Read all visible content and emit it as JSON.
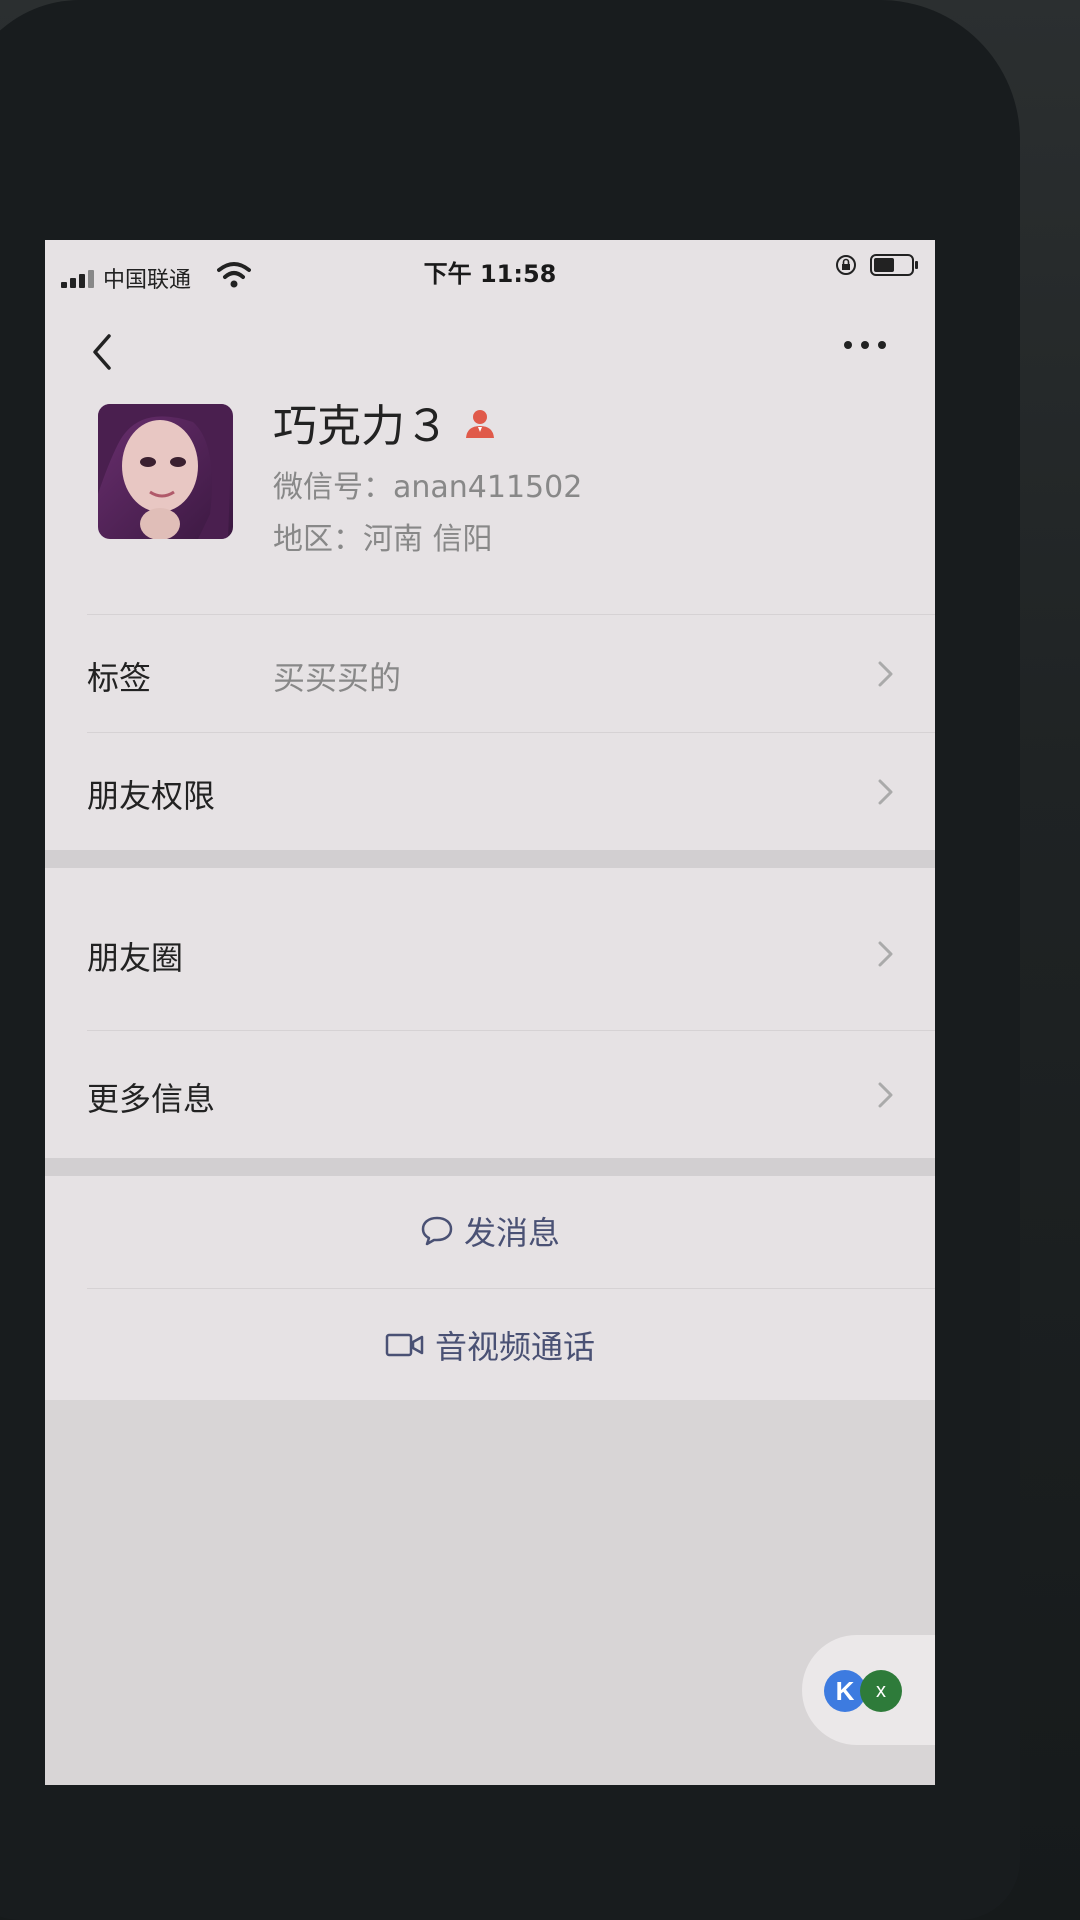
{
  "status_bar": {
    "carrier": "中国联通",
    "time": "下午 11:58"
  },
  "nav": {
    "back_icon": "chevron-left-icon",
    "more_icon": "more-dots-icon"
  },
  "profile": {
    "nickname": "巧克力３",
    "wechat_id_label": "微信号：",
    "wechat_id": "anan411502",
    "region_label": "地区：",
    "region": "河南 信阳",
    "gender_icon": "female-user-icon"
  },
  "rows": {
    "tags_label": "标签",
    "tags_value": "买买买的",
    "permissions_label": "朋友权限",
    "moments_label": "朋友圈",
    "more_info_label": "更多信息"
  },
  "actions": {
    "message_label": "发消息",
    "call_label": "音视频通话"
  },
  "float_widget": {
    "k_text": "K",
    "close_text": "x"
  },
  "colors": {
    "screen_bg": "#e6e2e4",
    "action_text": "#4a5174",
    "gender_icon": "#e05a4a"
  }
}
